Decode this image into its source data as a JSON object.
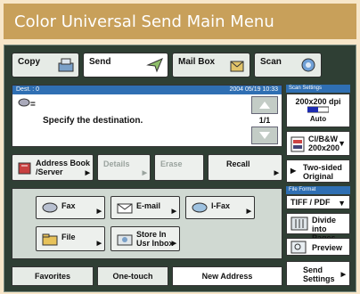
{
  "caption": "Color Universal Send Main Menu",
  "tabs": [
    {
      "label": "Copy",
      "icon": "copier-icon"
    },
    {
      "label": "Send",
      "icon": "send-icon"
    },
    {
      "label": "Mail Box",
      "icon": "mailbox-icon"
    },
    {
      "label": "Scan",
      "icon": "scanner-icon"
    }
  ],
  "destination": {
    "count_label": "Dest. : 0",
    "datetime": "2004 05/19 10:33",
    "prompt": "Specify the destination.",
    "page": "1/1"
  },
  "actions": {
    "address_book": "Address Book /Server",
    "details": "Details",
    "erase": "Erase",
    "recall": "Recall"
  },
  "send_methods": {
    "fax": "Fax",
    "email": "E-mail",
    "ifax": "I-Fax",
    "file": "File",
    "store": "Store In Usr Inbox"
  },
  "bottom_tabs": [
    "Favorites",
    "One-touch",
    "New Address"
  ],
  "scan_settings": {
    "header": "Scan Settings",
    "resolution": "200x200 dpi",
    "density": "Auto",
    "color_mode": "Cl/B&W",
    "color_res": "200x200",
    "two_sided": "Two-sided Original"
  },
  "file_format": {
    "header": "File Format",
    "value": "TIFF / PDF",
    "divide": "Divide into Pages",
    "preview": "Preview",
    "send_settings": "Send Settings"
  }
}
